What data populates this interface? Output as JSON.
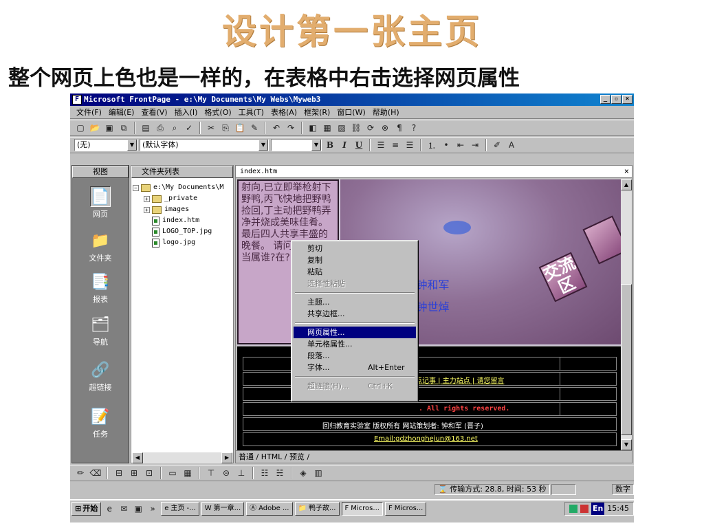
{
  "slide": {
    "title": "设计第一张主页",
    "subtitle": "整个网页上色也是一样的，在表格中右击选择网页属性"
  },
  "window": {
    "title": "Microsoft FrontPage - e:\\My Documents\\My Webs\\Myweb3",
    "controls": [
      "_",
      "▫",
      "×"
    ]
  },
  "menubar": [
    "文件(F)",
    "编辑(E)",
    "查看(V)",
    "插入(I)",
    "格式(O)",
    "工具(T)",
    "表格(A)",
    "框架(R)",
    "窗口(W)",
    "帮助(H)"
  ],
  "format_toolbar": {
    "style_value": "(无)",
    "font_value": "(默认字体)",
    "size_value": "",
    "bold": "B",
    "italic": "I",
    "underline": "U"
  },
  "views": {
    "header": "视图",
    "items": [
      {
        "label": "网页",
        "icon": "page-view-icon",
        "selected": true
      },
      {
        "label": "文件夹",
        "icon": "folder-view-icon",
        "selected": false
      },
      {
        "label": "报表",
        "icon": "reports-view-icon",
        "selected": false
      },
      {
        "label": "导航",
        "icon": "navigation-view-icon",
        "selected": false
      },
      {
        "label": "超链接",
        "icon": "hyperlinks-view-icon",
        "selected": false
      },
      {
        "label": "任务",
        "icon": "tasks-view-icon",
        "selected": false
      }
    ]
  },
  "folder_list": {
    "header": "文件夹列表",
    "items": [
      {
        "name": "e:\\My Documents\\M",
        "type": "root"
      },
      {
        "name": "_private",
        "type": "folder"
      },
      {
        "name": "images",
        "type": "folder"
      },
      {
        "name": "index.htm",
        "type": "page"
      },
      {
        "name": "LOGO_TOP.jpg",
        "type": "image"
      },
      {
        "name": "logo.jpg",
        "type": "image"
      }
    ]
  },
  "editor": {
    "file_tab": "index.htm",
    "close": "×",
    "text_column": "射向,已立即举枪射下野鸭,丙飞快地把野鸭捡回,丁主动把野鸭弄净并烧成美味佳肴。最后四人共享丰盛的晚餐。 请问:贡献最大当属谁?在?",
    "authors": [
      "者: 钟和军",
      "者: 钟世焯"
    ],
    "sign_text": "交流区",
    "footer": {
      "links": "站点记事 | 主力站点 | 请您留言",
      "rights": ". All rights reserved.",
      "copyright": "回归教育实验室 版权所有 网站策划者: 钟和军 (晋子)",
      "email": "Email:gdzhonghejun@163.net"
    },
    "view_tabs": "普通 / HTML / 预览 /"
  },
  "context_menu": {
    "groups": [
      [
        {
          "label": "剪切",
          "enabled": true
        },
        {
          "label": "复制",
          "enabled": true
        },
        {
          "label": "粘贴",
          "enabled": true
        },
        {
          "label": "选择性粘贴",
          "enabled": false
        }
      ],
      [
        {
          "label": "主题...",
          "enabled": true
        },
        {
          "label": "共享边框...",
          "enabled": true
        }
      ],
      [
        {
          "label": "网页属性...",
          "enabled": true,
          "selected": true
        },
        {
          "label": "单元格属性...",
          "enabled": true
        },
        {
          "label": "段落...",
          "enabled": true
        },
        {
          "label": "字体...",
          "enabled": true,
          "shortcut": "Alt+Enter"
        }
      ],
      [
        {
          "label": "超链接(H)...",
          "enabled": false,
          "shortcut": "Ctrl+K"
        }
      ]
    ]
  },
  "statusbar": {
    "transfer": "传输方式: 28.8, 时间: 53 秒",
    "mode": "数字"
  },
  "taskbar": {
    "start": "开始",
    "tasks": [
      "主页 -...",
      "第一章...",
      "Adobe ...",
      "鸭子故...",
      "Micros...",
      "Micros..."
    ],
    "lang": "En",
    "clock": "15:45"
  },
  "colors": {
    "title_gold": "#e2ad6e",
    "titlebar": "#00007b",
    "menu_highlight": "#000080",
    "author_blue": "#2a3fd8",
    "footer_link": "#ffff66",
    "footer_red": "#ff4444"
  }
}
